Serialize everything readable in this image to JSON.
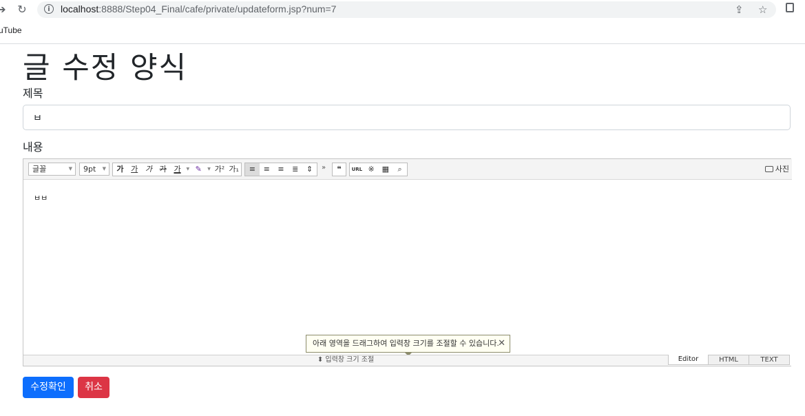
{
  "browser": {
    "url_host": "localhost",
    "url_rest": ":8888/Step04_Final/cafe/private/updateform.jsp?num=7",
    "bookmark": "uTube"
  },
  "page": {
    "title": "글 수정 양식",
    "subject_label": "제목",
    "subject_value": "ㅂ",
    "content_label": "내용",
    "content_text": "ㅂㅂ"
  },
  "editor": {
    "font_select": "글꼴",
    "size_select": "9pt",
    "photo_button": "사진",
    "url_button": "URL",
    "tooltip": "아래 영역을 드래그하여 입력창 크기를 조절할 수 있습니다.",
    "resize_label": "입력창 크기 조절",
    "modes": [
      "Editor",
      "HTML",
      "TEXT"
    ]
  },
  "buttons": {
    "submit": "수정확인",
    "cancel": "취소"
  }
}
